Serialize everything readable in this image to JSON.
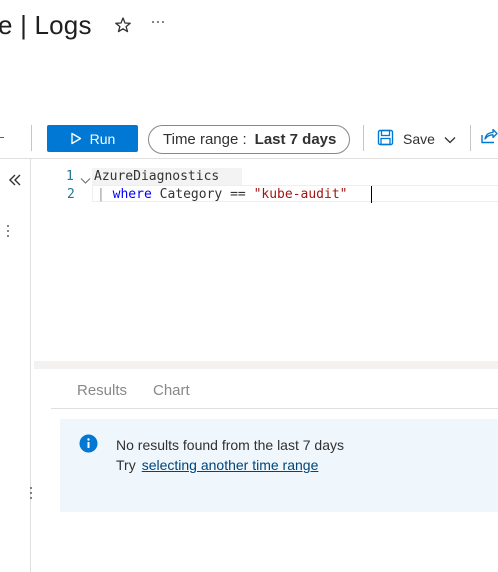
{
  "header": {
    "title": "e | Logs",
    "icons": [
      "star-icon",
      "more-icon"
    ]
  },
  "toolbar": {
    "run_label": "Run",
    "time_range_label": "Time range :",
    "time_range_value": "Last 7 days",
    "save_label": "Save",
    "icons": [
      "play-icon",
      "save-icon",
      "chevron-down-icon",
      "share-icon"
    ]
  },
  "editor": {
    "line_numbers": [
      "1",
      "2"
    ],
    "line1": "AzureDiagnostics",
    "line2": {
      "pipe": "|",
      "keyword": "where",
      "field": "Category",
      "operator": "==",
      "string": "\"kube-audit\""
    }
  },
  "sidebar": {
    "icons": [
      "collapse-icon",
      "more-vertical-icon"
    ]
  },
  "results": {
    "tabs": [
      {
        "label": "Results"
      },
      {
        "label": "Chart"
      }
    ],
    "message": "No results found from the last 7 days",
    "try_label": "Try",
    "link_label": "selecting another time range"
  },
  "colors": {
    "accent": "#0078d4",
    "info_background": "#eff6fc",
    "keyword": "#0000ff",
    "string": "#a31515",
    "link": "#004578"
  }
}
